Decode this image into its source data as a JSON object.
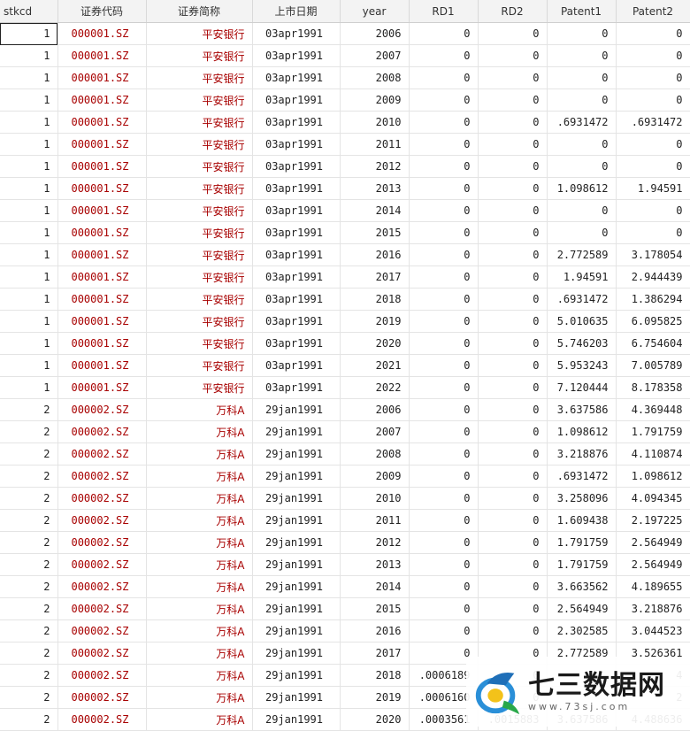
{
  "columns": [
    "stkcd",
    "证券代码",
    "证券简称",
    "上市日期",
    "year",
    "RD1",
    "RD2",
    "Patent1",
    "Patent2"
  ],
  "rows": [
    [
      "1",
      "000001.SZ",
      "平安银行",
      "03apr1991",
      "2006",
      "0",
      "0",
      "0",
      "0"
    ],
    [
      "1",
      "000001.SZ",
      "平安银行",
      "03apr1991",
      "2007",
      "0",
      "0",
      "0",
      "0"
    ],
    [
      "1",
      "000001.SZ",
      "平安银行",
      "03apr1991",
      "2008",
      "0",
      "0",
      "0",
      "0"
    ],
    [
      "1",
      "000001.SZ",
      "平安银行",
      "03apr1991",
      "2009",
      "0",
      "0",
      "0",
      "0"
    ],
    [
      "1",
      "000001.SZ",
      "平安银行",
      "03apr1991",
      "2010",
      "0",
      "0",
      ".6931472",
      ".6931472"
    ],
    [
      "1",
      "000001.SZ",
      "平安银行",
      "03apr1991",
      "2011",
      "0",
      "0",
      "0",
      "0"
    ],
    [
      "1",
      "000001.SZ",
      "平安银行",
      "03apr1991",
      "2012",
      "0",
      "0",
      "0",
      "0"
    ],
    [
      "1",
      "000001.SZ",
      "平安银行",
      "03apr1991",
      "2013",
      "0",
      "0",
      "1.098612",
      "1.94591"
    ],
    [
      "1",
      "000001.SZ",
      "平安银行",
      "03apr1991",
      "2014",
      "0",
      "0",
      "0",
      "0"
    ],
    [
      "1",
      "000001.SZ",
      "平安银行",
      "03apr1991",
      "2015",
      "0",
      "0",
      "0",
      "0"
    ],
    [
      "1",
      "000001.SZ",
      "平安银行",
      "03apr1991",
      "2016",
      "0",
      "0",
      "2.772589",
      "3.178054"
    ],
    [
      "1",
      "000001.SZ",
      "平安银行",
      "03apr1991",
      "2017",
      "0",
      "0",
      "1.94591",
      "2.944439"
    ],
    [
      "1",
      "000001.SZ",
      "平安银行",
      "03apr1991",
      "2018",
      "0",
      "0",
      ".6931472",
      "1.386294"
    ],
    [
      "1",
      "000001.SZ",
      "平安银行",
      "03apr1991",
      "2019",
      "0",
      "0",
      "5.010635",
      "6.095825"
    ],
    [
      "1",
      "000001.SZ",
      "平安银行",
      "03apr1991",
      "2020",
      "0",
      "0",
      "5.746203",
      "6.754604"
    ],
    [
      "1",
      "000001.SZ",
      "平安银行",
      "03apr1991",
      "2021",
      "0",
      "0",
      "5.953243",
      "7.005789"
    ],
    [
      "1",
      "000001.SZ",
      "平安银行",
      "03apr1991",
      "2022",
      "0",
      "0",
      "7.120444",
      "8.178358"
    ],
    [
      "2",
      "000002.SZ",
      "万科A",
      "29jan1991",
      "2006",
      "0",
      "0",
      "3.637586",
      "4.369448"
    ],
    [
      "2",
      "000002.SZ",
      "万科A",
      "29jan1991",
      "2007",
      "0",
      "0",
      "1.098612",
      "1.791759"
    ],
    [
      "2",
      "000002.SZ",
      "万科A",
      "29jan1991",
      "2008",
      "0",
      "0",
      "3.218876",
      "4.110874"
    ],
    [
      "2",
      "000002.SZ",
      "万科A",
      "29jan1991",
      "2009",
      "0",
      "0",
      ".6931472",
      "1.098612"
    ],
    [
      "2",
      "000002.SZ",
      "万科A",
      "29jan1991",
      "2010",
      "0",
      "0",
      "3.258096",
      "4.094345"
    ],
    [
      "2",
      "000002.SZ",
      "万科A",
      "29jan1991",
      "2011",
      "0",
      "0",
      "1.609438",
      "2.197225"
    ],
    [
      "2",
      "000002.SZ",
      "万科A",
      "29jan1991",
      "2012",
      "0",
      "0",
      "1.791759",
      "2.564949"
    ],
    [
      "2",
      "000002.SZ",
      "万科A",
      "29jan1991",
      "2013",
      "0",
      "0",
      "1.791759",
      "2.564949"
    ],
    [
      "2",
      "000002.SZ",
      "万科A",
      "29jan1991",
      "2014",
      "0",
      "0",
      "3.663562",
      "4.189655"
    ],
    [
      "2",
      "000002.SZ",
      "万科A",
      "29jan1991",
      "2015",
      "0",
      "0",
      "2.564949",
      "3.218876"
    ],
    [
      "2",
      "000002.SZ",
      "万科A",
      "29jan1991",
      "2016",
      "0",
      "0",
      "2.302585",
      "3.044523"
    ],
    [
      "2",
      "000002.SZ",
      "万科A",
      "29jan1991",
      "2017",
      "0",
      "0",
      "2.772589",
      "3.526361"
    ],
    [
      "2",
      "000002.SZ",
      "万科A",
      "29jan1991",
      "2018",
      ".0006189",
      "0",
      "",
      "4"
    ],
    [
      "2",
      "000002.SZ",
      "万科A",
      "29jan1991",
      "2019",
      ".0006160",
      "0",
      "",
      "2"
    ],
    [
      "2",
      "000002.SZ",
      "万科A",
      "29jan1991",
      "2020",
      ".0003561",
      ".0015883",
      "3.637586",
      "4.488636"
    ]
  ],
  "watermark": {
    "title": "七三数据网",
    "url": "www.73sj.com",
    "icon": "dragon-logo-icon"
  },
  "colors": {
    "code_text": "#a80000",
    "header_bg": "#f3f3f3",
    "grid": "#e4e4e4"
  }
}
